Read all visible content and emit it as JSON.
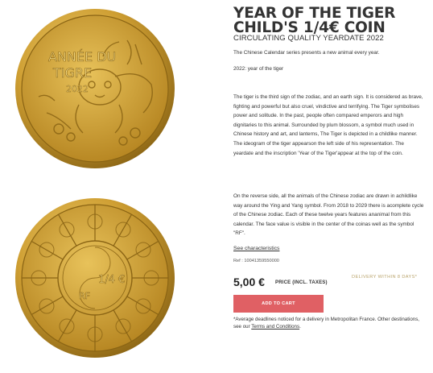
{
  "product": {
    "title_line1": "YEAR OF THE TIGER",
    "title_line2": "CHILD'S 1/4€ COIN",
    "subtitle": "CIRCULATING QUALITY YEARDATE 2022"
  },
  "description": {
    "intro": "The Chinese Calendar series presents a new animal every year.",
    "year_line": "2022: year of the tiger",
    "obverse": "The tiger is the third sign of the zodiac, and an earth sign. It is considered as brave, fighting and powerful but also cruel, vindictive and terrifying. The Tiger symbolises power and solitude. In the past, people often compared emperors and high dignitaries to this animal. Surrounded by plum blossom, a symbol much used in Chinese history and art, and lanterns, The Tiger is depicted in a childlike manner. The ideogram of the tiger appearson the left side of his representation. The yeardate and the inscription 'Year of the Tiger'appear at the top of the coin.",
    "reverse": "On the reverse side, all the animals of the Chinese zodiac are drawn in achildlike way around the Ying and Yang symbol. From 2018 to 2029 there is acomplete cycle of the Chinese zodiac. Each of these twelve years features ananimal from this calendar. The face value is visible in the center of the coinas well as the symbol \"RF\"."
  },
  "characteristics_link": "See characteristics",
  "reference": "Ref : 10041359550000",
  "price": {
    "amount": "5,00 €",
    "note": "PRICE (INCL. TAXES)"
  },
  "delivery": "DELIVERY WITHIN 8 DAYS*",
  "add_to_cart": "ADD TO CART",
  "footnote": {
    "text": "*Average deadlines noticed for a delivery in Metropolitan France. Other destinations, see our ",
    "link": "Terms and Conditions",
    "end": "."
  },
  "coin": {
    "front_inscription_1": "ANNÉE DU",
    "front_inscription_2": "TIGRE",
    "front_year": "2022",
    "back_value": "1/4 €",
    "back_symbol": "RF"
  },
  "colors": {
    "gold_light": "#e9c860",
    "gold_mid": "#c99a2e",
    "gold_dark": "#8a6414",
    "button": "#e06064",
    "delivery_text": "#b9a36a"
  }
}
